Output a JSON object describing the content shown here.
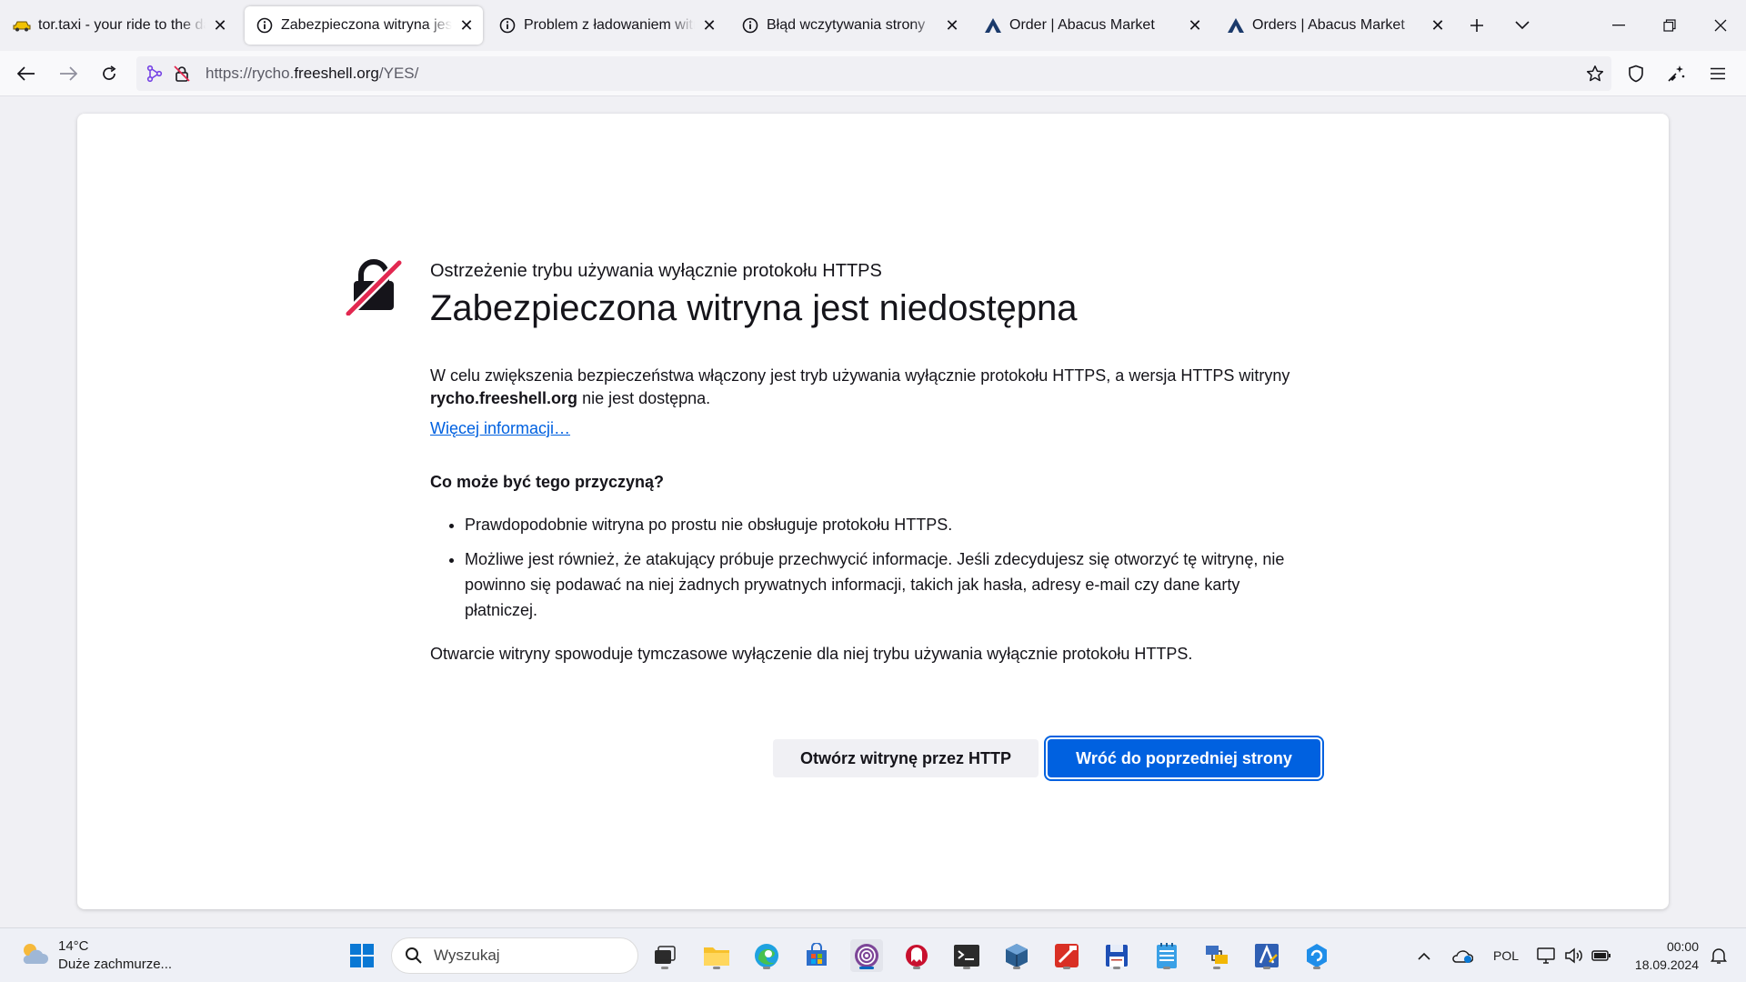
{
  "tabs": [
    {
      "label": "tor.taxi - your ride to the darkweb",
      "icon": "taxi-icon",
      "active": false
    },
    {
      "label": "Zabezpieczona witryna jest niedostępna",
      "icon": "info-icon",
      "active": true
    },
    {
      "label": "Problem z ładowaniem witryny",
      "icon": "info-icon",
      "active": false
    },
    {
      "label": "Błąd wczytywania strony",
      "icon": "info-icon",
      "active": false
    },
    {
      "label": "Order | Abacus Market",
      "icon": "abacus-icon",
      "active": false
    },
    {
      "label": "Orders | Abacus Market",
      "icon": "abacus-icon",
      "active": false
    }
  ],
  "urlbar": {
    "scheme": "https://rycho.",
    "host": "freeshell.org",
    "path": "/YES/"
  },
  "error_page": {
    "pre_title": "Ostrzeżenie trybu używania wyłącznie protokołu HTTPS",
    "title": "Zabezpieczona witryna jest niedostępna",
    "intro_text": "W celu zwiększenia bezpieczeństwa włączony jest tryb używania wyłącznie protokołu HTTPS, a wersja HTTPS witryny ",
    "intro_host": "rycho.freeshell.org",
    "intro_end": " nie jest dostępna.",
    "more_info_link": "Więcej informacji…",
    "causes_heading": "Co może być tego przyczyną?",
    "causes": [
      "Prawdopodobnie witryna po prostu nie obsługuje protokołu HTTPS.",
      "Możliwe jest również, że atakujący próbuje przechwycić informacje. Jeśli zdecydujesz się otworzyć tę witrynę, nie powinno się podawać na niej żadnych prywatnych informacji, takich jak hasła, adresy e-mail czy dane karty płatniczej."
    ],
    "note": "Otwarcie witryny spowoduje tymczasowe wyłączenie dla niej trybu używania wyłącznie protokołu HTTPS.",
    "btn_open_http": "Otwórz witrynę przez HTTP",
    "btn_go_back": "Wróć do poprzedniej strony"
  },
  "taskbar": {
    "weather_temp": "14°C",
    "weather_desc": "Duże zachmurze...",
    "search_placeholder": "Wyszukaj",
    "language": "POL",
    "time": "00:00",
    "date": "18.09.2024"
  },
  "colors": {
    "accent": "#0061e0",
    "lock_slash": "#e22850"
  }
}
